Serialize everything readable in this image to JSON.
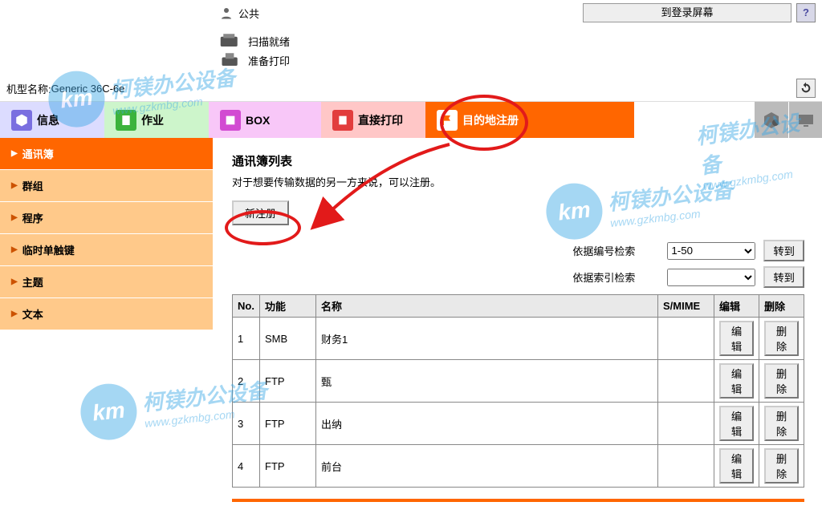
{
  "header": {
    "user_label": "公共",
    "login_button": "到登录屏幕",
    "help": "?"
  },
  "status": {
    "scan": "扫描就绪",
    "print": "准备打印"
  },
  "model": {
    "label": "机型名称:",
    "value": "Generic 36C-6e"
  },
  "tabs": {
    "info": "信息",
    "job": "作业",
    "box": "BOX",
    "direct_print": "直接打印",
    "dest_register": "目的地注册"
  },
  "sidebar": {
    "items": [
      {
        "label": "通讯簿",
        "active": true
      },
      {
        "label": "群组",
        "active": false
      },
      {
        "label": "程序",
        "active": false
      },
      {
        "label": "临时单触键",
        "active": false
      },
      {
        "label": "主题",
        "active": false
      },
      {
        "label": "文本",
        "active": false
      }
    ]
  },
  "main": {
    "title": "通讯簿列表",
    "subtitle": "对于想要传输数据的另一方来说，可以注册。",
    "new_button": "新注册",
    "search_by_number": "依据编号检索",
    "search_by_index": "依据索引检索",
    "range_option": "1-50",
    "go": "转到",
    "columns": {
      "no": "No.",
      "func": "功能",
      "name": "名称",
      "smime": "S/MIME",
      "edit": "编辑",
      "del": "删除"
    },
    "rows": [
      {
        "no": "1",
        "func": "SMB",
        "name": "财务1",
        "smime": ""
      },
      {
        "no": "2",
        "func": "FTP",
        "name": "甄",
        "smime": ""
      },
      {
        "no": "3",
        "func": "FTP",
        "name": "出纳",
        "smime": ""
      },
      {
        "no": "4",
        "func": "FTP",
        "name": "前台",
        "smime": ""
      }
    ],
    "edit_btn": "编辑",
    "del_btn": "删除"
  },
  "watermark": {
    "brand_cn": "柯镁办公设备",
    "brand_url": "www.gzkmbg.com",
    "logo": "km"
  }
}
